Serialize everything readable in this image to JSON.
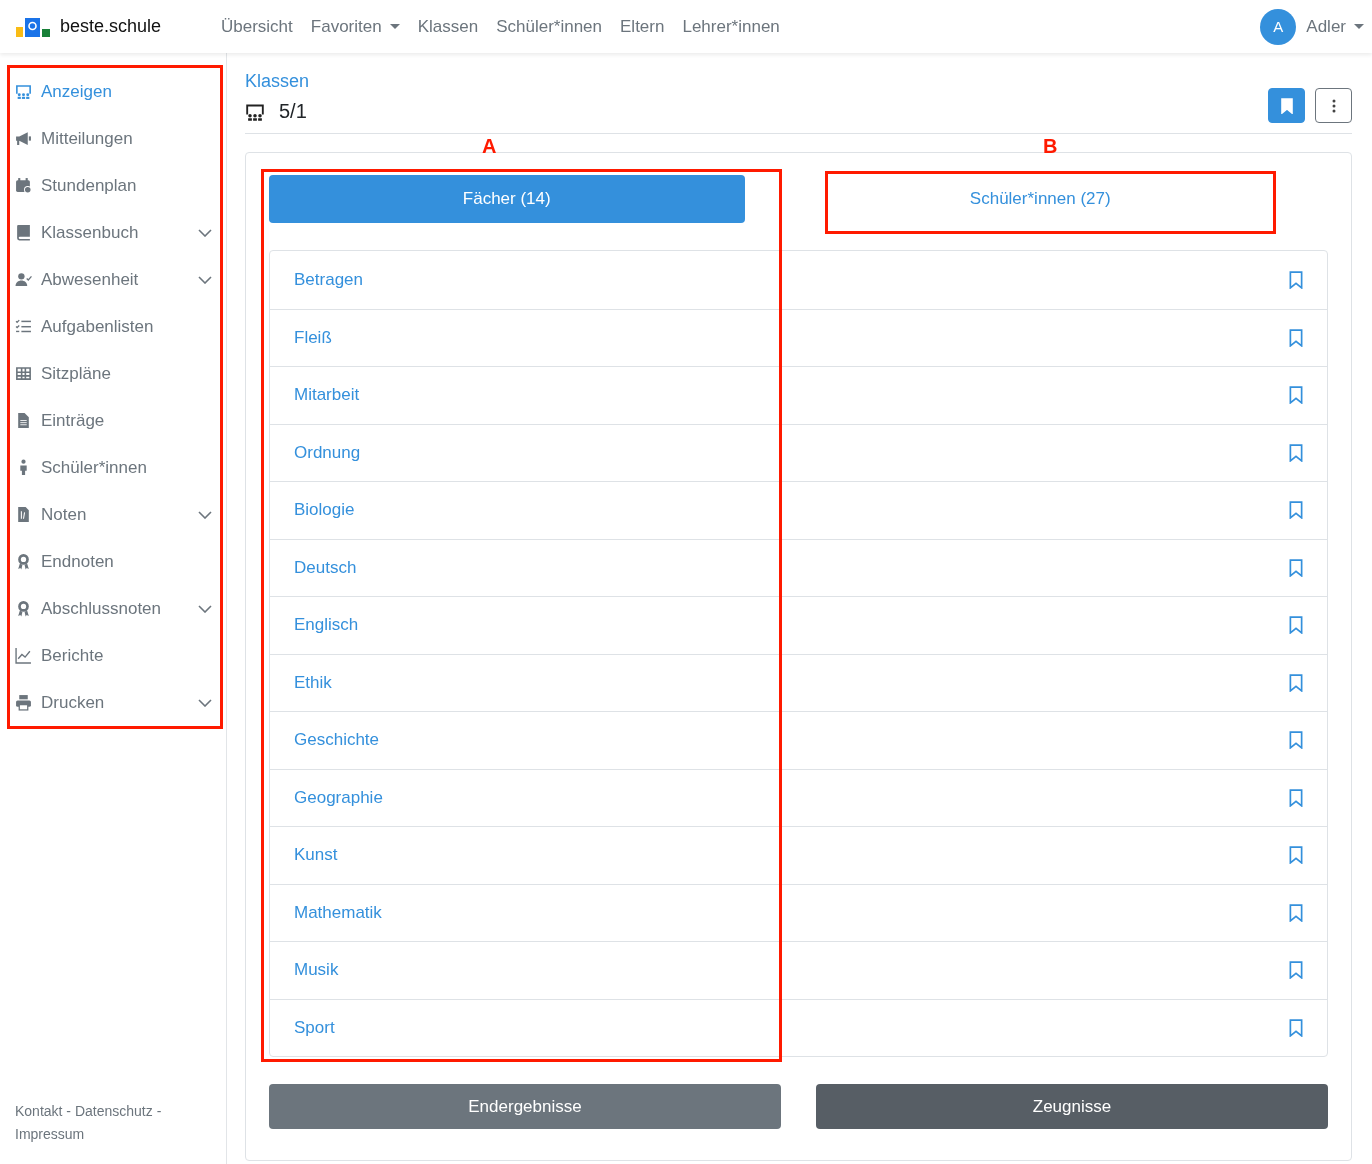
{
  "brand": {
    "name": "beste.schule"
  },
  "nav": [
    {
      "label": "Übersicht",
      "dropdown": false
    },
    {
      "label": "Favoriten",
      "dropdown": true
    },
    {
      "label": "Klassen",
      "dropdown": false
    },
    {
      "label": "Schüler*innen",
      "dropdown": false
    },
    {
      "label": "Eltern",
      "dropdown": false
    },
    {
      "label": "Lehrer*innen",
      "dropdown": false
    }
  ],
  "user": {
    "initial": "A",
    "name": "Adler"
  },
  "sidebar": {
    "items": [
      {
        "label": "Anzeigen",
        "selected": true,
        "expandable": false
      },
      {
        "label": "Mitteilungen",
        "selected": false,
        "expandable": false
      },
      {
        "label": "Stundenplan",
        "selected": false,
        "expandable": false
      },
      {
        "label": "Klassenbuch",
        "selected": false,
        "expandable": true
      },
      {
        "label": "Abwesenheit",
        "selected": false,
        "expandable": true
      },
      {
        "label": "Aufgabenlisten",
        "selected": false,
        "expandable": false
      },
      {
        "label": "Sitzpläne",
        "selected": false,
        "expandable": false
      },
      {
        "label": "Einträge",
        "selected": false,
        "expandable": false
      },
      {
        "label": "Schüler*innen",
        "selected": false,
        "expandable": false
      },
      {
        "label": "Noten",
        "selected": false,
        "expandable": true
      },
      {
        "label": "Endnoten",
        "selected": false,
        "expandable": false
      },
      {
        "label": "Abschlussnoten",
        "selected": false,
        "expandable": true
      },
      {
        "label": "Berichte",
        "selected": false,
        "expandable": false
      },
      {
        "label": "Drucken",
        "selected": false,
        "expandable": true
      }
    ],
    "footer": "Kontakt - Datenschutz - Impressum"
  },
  "header": {
    "breadcrumb": "Klassen",
    "title": "5/1",
    "bookmarked": true
  },
  "tabs": [
    {
      "label": "Fächer (14)",
      "selected": true
    },
    {
      "label": "Schüler*innen (27)",
      "selected": false
    }
  ],
  "subjects": [
    "Betragen",
    "Fleiß",
    "Mitarbeit",
    "Ordnung",
    "Biologie",
    "Deutsch",
    "Englisch",
    "Ethik",
    "Geschichte",
    "Geographie",
    "Kunst",
    "Mathematik",
    "Musik",
    "Sport"
  ],
  "buttons": [
    {
      "label": "Endergebnisse",
      "kind": "secondary"
    },
    {
      "label": "Zeugnisse",
      "kind": "dark"
    }
  ],
  "sidebar_annotated": true,
  "annotations": [
    {
      "label": "A"
    },
    {
      "label": "B"
    }
  ]
}
